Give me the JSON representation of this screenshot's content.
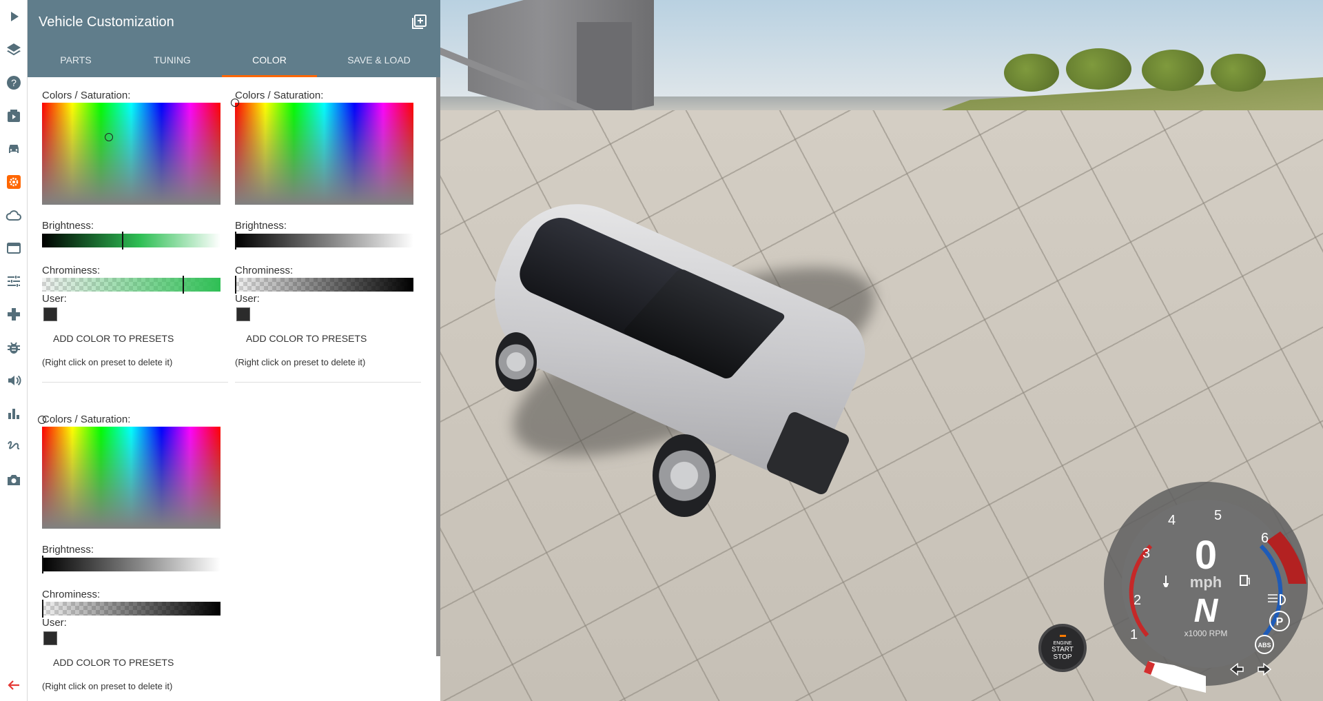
{
  "panel": {
    "title": "Vehicle Customization",
    "tabs": [
      {
        "label": "PARTS",
        "active": false
      },
      {
        "label": "TUNING",
        "active": false
      },
      {
        "label": "COLOR",
        "active": true
      },
      {
        "label": "SAVE & LOAD",
        "active": false
      }
    ],
    "accent_color": "#ff6600",
    "header_color": "#607d8b"
  },
  "pickers": [
    {
      "colors_label": "Colors / Saturation:",
      "brightness_label": "Brightness:",
      "chrominess_label": "Chrominess:",
      "user_label": "User:",
      "add_button": "ADD COLOR TO PRESETS",
      "note": "(Right click on preset to delete it)",
      "brightness_value": 0.45,
      "chrominess_value": 0.8,
      "selected_hue_color": "#2fbf55"
    },
    {
      "colors_label": "Colors / Saturation:",
      "brightness_label": "Brightness:",
      "chrominess_label": "Chrominess:",
      "user_label": "User:",
      "add_button": "ADD COLOR TO PRESETS",
      "note": "(Right click on preset to delete it)",
      "brightness_value": 0.0,
      "chrominess_value": 0.0,
      "selected_hue_color": "#ff0000"
    },
    {
      "colors_label": "Colors / Saturation:",
      "brightness_label": "Brightness:",
      "chrominess_label": "Chrominess:",
      "user_label": "User:",
      "add_button": "ADD COLOR TO PRESETS",
      "note": "(Right click on preset to delete it)",
      "brightness_value": 0.0,
      "chrominess_value": 0.0,
      "selected_hue_color": "#ff0000"
    }
  ],
  "sidebar_icons": [
    "play-icon",
    "layers-icon",
    "help-icon",
    "clapperboard-icon",
    "car-icon",
    "settings-gear-icon",
    "cloud-icon",
    "web-asset-icon",
    "tune-sliders-icon",
    "gamepad-icon",
    "bug-icon",
    "volume-icon",
    "bar-chart-icon",
    "gesture-icon",
    "camera-icon",
    "arrow-back-icon"
  ],
  "hud": {
    "engine_button": {
      "line1": "ENGINE",
      "line2": "START",
      "line3": "STOP"
    },
    "speed": "0",
    "speed_unit": "mph",
    "gear": "N",
    "rpm_unit": "x1000 RPM",
    "rpm_ticks": [
      "1",
      "2",
      "3",
      "4",
      "5",
      "6"
    ],
    "abs_label": "ABS",
    "parking_label": "P"
  }
}
